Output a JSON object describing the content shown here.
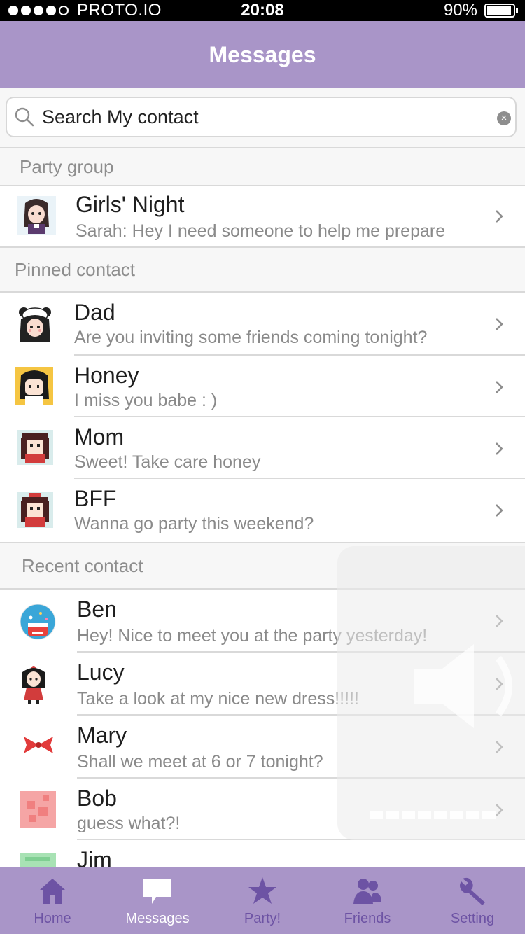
{
  "status_bar": {
    "carrier": "PROTO.IO",
    "time": "20:08",
    "battery": "90%",
    "signal_bars_filled": 4,
    "signal_bars_total": 5,
    "battery_level": 0.9
  },
  "nav": {
    "title": "Messages"
  },
  "search": {
    "placeholder": "Search My contact"
  },
  "sections": {
    "party_group": "Party group",
    "pinned": "Pinned contact",
    "recent": "Recent contact"
  },
  "party_group": [
    {
      "name": "Girls' Night",
      "preview": "Sarah: Hey I need someone to help me prepare",
      "avatar_icon": "girl-avatar-icon"
    }
  ],
  "pinned": [
    {
      "name": "Dad",
      "preview": "Are you inviting some friends coming tonight?",
      "avatar_icon": "panda-girl-avatar-icon"
    },
    {
      "name": "Honey",
      "preview": "I miss you babe : )",
      "avatar_icon": "girl-yellow-avatar-icon"
    },
    {
      "name": "Mom",
      "preview": "Sweet! Take care honey",
      "avatar_icon": "pixel-girl-avatar-icon"
    },
    {
      "name": "BFF",
      "preview": "Wanna go party this weekend?",
      "avatar_icon": "pixel-bow-girl-avatar-icon"
    }
  ],
  "recent": [
    {
      "name": "Ben",
      "preview": "Hey! Nice to meet you at the party yesterday!",
      "avatar_icon": "cake-avatar-icon"
    },
    {
      "name": "Lucy",
      "preview": "Take a look at my nice new dress!!!!!",
      "avatar_icon": "girl-dress-avatar-icon"
    },
    {
      "name": "Mary",
      "preview": "Shall we meet at 6 or 7 tonight?",
      "avatar_icon": "red-bow-avatar-icon"
    },
    {
      "name": "Bob",
      "preview": "guess what?!",
      "avatar_icon": "pink-pattern-avatar-icon"
    },
    {
      "name": "Jim",
      "preview": "",
      "avatar_icon": "green-pattern-avatar-icon"
    }
  ],
  "tabs": [
    {
      "label": "Home",
      "icon": "home-icon",
      "active": false
    },
    {
      "label": "Messages",
      "icon": "chat-bubble-icon",
      "active": true
    },
    {
      "label": "Party!",
      "icon": "star-icon",
      "active": false
    },
    {
      "label": "Friends",
      "icon": "friends-icon",
      "active": false
    },
    {
      "label": "Setting",
      "icon": "wrench-icon",
      "active": false
    }
  ],
  "colors": {
    "accent": "#a995c8",
    "tab_inactive": "#6d53a4",
    "tab_active": "#ffffff",
    "section_text": "#8e8e8e"
  }
}
